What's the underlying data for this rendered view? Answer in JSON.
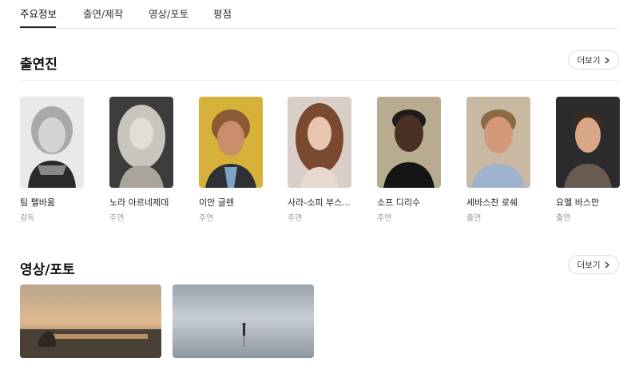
{
  "tabs": [
    {
      "label": "주요정보",
      "active": true
    },
    {
      "label": "출연/제작",
      "active": false
    },
    {
      "label": "영상/포토",
      "active": false
    },
    {
      "label": "평점",
      "active": false
    }
  ],
  "cast_section": {
    "title": "출연진",
    "more_label": "더보기",
    "members": [
      {
        "name": "팀 펠바움",
        "role": "감독"
      },
      {
        "name": "노라 아르네제데",
        "role": "주연"
      },
      {
        "name": "이안 글렌",
        "role": "주연"
      },
      {
        "name": "사라-소피 부스...",
        "role": "주연"
      },
      {
        "name": "소프 디리수",
        "role": "주연"
      },
      {
        "name": "세바스찬 로쉐",
        "role": "출연"
      },
      {
        "name": "요엘 바스만",
        "role": "출연"
      }
    ]
  },
  "media_section": {
    "title": "영상/포토",
    "more_label": "더보기",
    "items": [
      {
        "icon": "sunset-beach-photo"
      },
      {
        "icon": "salt-flat-photo"
      }
    ]
  },
  "colors": {
    "text_primary": "#111111",
    "text_secondary": "#999999",
    "border": "#dcdcdc",
    "divider": "#eeeeee"
  }
}
